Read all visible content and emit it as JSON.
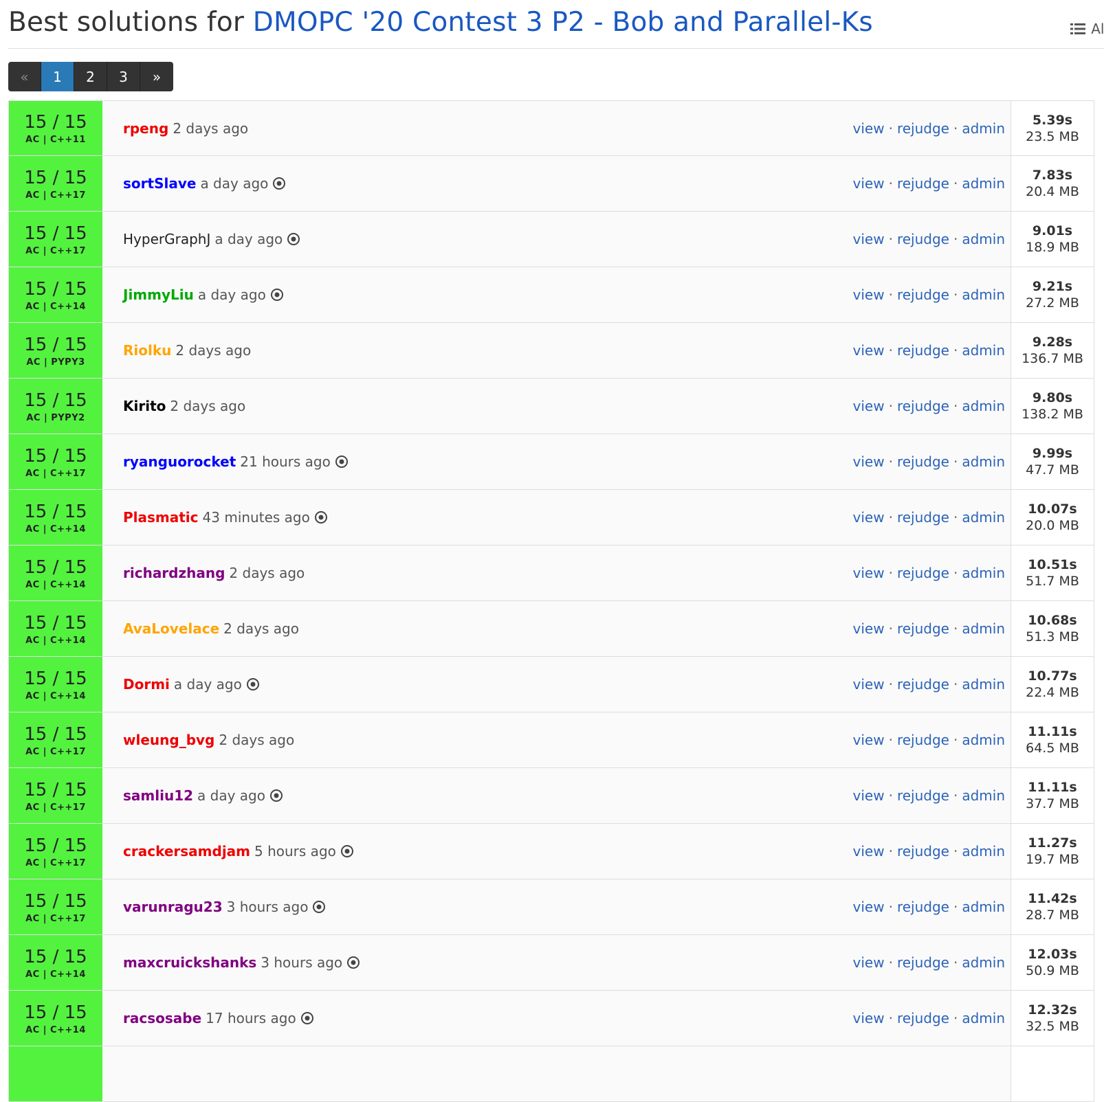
{
  "header": {
    "title_prefix": "Best solutions for ",
    "problem_title": "DMOPC '20 Contest 3 P2 - Bob and Parallel-Ks",
    "all_label": "All"
  },
  "pagination": {
    "prev": "«",
    "pages": [
      "1",
      "2",
      "3"
    ],
    "active": "1",
    "next": "»"
  },
  "actions": {
    "view": "view",
    "sep": "·",
    "rejudge": "rejudge",
    "admin": "admin"
  },
  "colors": {
    "accepted": "#53f23f",
    "link": "#2c63b8",
    "rank_red": "#ee0000",
    "rank_blue": "#0000ff",
    "rank_green": "#00a900",
    "rank_orange": "#ffa500",
    "rank_purple": "#800080",
    "rank_black": "#000000",
    "rank_plain": "#222222"
  },
  "submissions": [
    {
      "score": "15 / 15",
      "status_lang": "AC | C++11",
      "user": "rpeng",
      "user_color": "#ee0000",
      "user_bold": true,
      "time": "2 days ago",
      "eye": false,
      "cpu": "5.39s",
      "mem": "23.5 MB"
    },
    {
      "score": "15 / 15",
      "status_lang": "AC | C++17",
      "user": "sortSlave",
      "user_color": "#0000ff",
      "user_bold": true,
      "time": "a day ago",
      "eye": true,
      "cpu": "7.83s",
      "mem": "20.4 MB"
    },
    {
      "score": "15 / 15",
      "status_lang": "AC | C++17",
      "user": "HyperGraphJ",
      "user_color": "#222222",
      "user_bold": false,
      "time": "a day ago",
      "eye": true,
      "cpu": "9.01s",
      "mem": "18.9 MB"
    },
    {
      "score": "15 / 15",
      "status_lang": "AC | C++14",
      "user": "JimmyLiu",
      "user_color": "#00a900",
      "user_bold": true,
      "time": "a day ago",
      "eye": true,
      "cpu": "9.21s",
      "mem": "27.2 MB"
    },
    {
      "score": "15 / 15",
      "status_lang": "AC | PYPY3",
      "user": "Riolku",
      "user_color": "#ffa500",
      "user_bold": true,
      "time": "2 days ago",
      "eye": false,
      "cpu": "9.28s",
      "mem": "136.7 MB"
    },
    {
      "score": "15 / 15",
      "status_lang": "AC | PYPY2",
      "user": "Kirito",
      "user_color": "#000000",
      "user_bold": true,
      "time": "2 days ago",
      "eye": false,
      "cpu": "9.80s",
      "mem": "138.2 MB"
    },
    {
      "score": "15 / 15",
      "status_lang": "AC | C++17",
      "user": "ryanguorocket",
      "user_color": "#0000ff",
      "user_bold": true,
      "time": "21 hours ago",
      "eye": true,
      "cpu": "9.99s",
      "mem": "47.7 MB"
    },
    {
      "score": "15 / 15",
      "status_lang": "AC | C++14",
      "user": "Plasmatic",
      "user_color": "#ee0000",
      "user_bold": true,
      "time": "43 minutes ago",
      "eye": true,
      "cpu": "10.07s",
      "mem": "20.0 MB"
    },
    {
      "score": "15 / 15",
      "status_lang": "AC | C++14",
      "user": "richardzhang",
      "user_color": "#800080",
      "user_bold": true,
      "time": "2 days ago",
      "eye": false,
      "cpu": "10.51s",
      "mem": "51.7 MB"
    },
    {
      "score": "15 / 15",
      "status_lang": "AC | C++14",
      "user": "AvaLovelace",
      "user_color": "#ffa500",
      "user_bold": true,
      "time": "2 days ago",
      "eye": false,
      "cpu": "10.68s",
      "mem": "51.3 MB"
    },
    {
      "score": "15 / 15",
      "status_lang": "AC | C++14",
      "user": "Dormi",
      "user_color": "#ee0000",
      "user_bold": true,
      "time": "a day ago",
      "eye": true,
      "cpu": "10.77s",
      "mem": "22.4 MB"
    },
    {
      "score": "15 / 15",
      "status_lang": "AC | C++17",
      "user": "wleung_bvg",
      "user_color": "#ee0000",
      "user_bold": true,
      "time": "2 days ago",
      "eye": false,
      "cpu": "11.11s",
      "mem": "64.5 MB"
    },
    {
      "score": "15 / 15",
      "status_lang": "AC | C++17",
      "user": "samliu12",
      "user_color": "#800080",
      "user_bold": true,
      "time": "a day ago",
      "eye": true,
      "cpu": "11.11s",
      "mem": "37.7 MB"
    },
    {
      "score": "15 / 15",
      "status_lang": "AC | C++17",
      "user": "crackersamdjam",
      "user_color": "#ee0000",
      "user_bold": true,
      "time": "5 hours ago",
      "eye": true,
      "cpu": "11.27s",
      "mem": "19.7 MB"
    },
    {
      "score": "15 / 15",
      "status_lang": "AC | C++17",
      "user": "varunragu23",
      "user_color": "#800080",
      "user_bold": true,
      "time": "3 hours ago",
      "eye": true,
      "cpu": "11.42s",
      "mem": "28.7 MB"
    },
    {
      "score": "15 / 15",
      "status_lang": "AC | C++14",
      "user": "maxcruickshanks",
      "user_color": "#800080",
      "user_bold": true,
      "time": "3 hours ago",
      "eye": true,
      "cpu": "12.03s",
      "mem": "50.9 MB"
    },
    {
      "score": "15 / 15",
      "status_lang": "AC | C++14",
      "user": "racsosabe",
      "user_color": "#800080",
      "user_bold": true,
      "time": "17 hours ago",
      "eye": true,
      "cpu": "12.32s",
      "mem": "32.5 MB"
    }
  ]
}
